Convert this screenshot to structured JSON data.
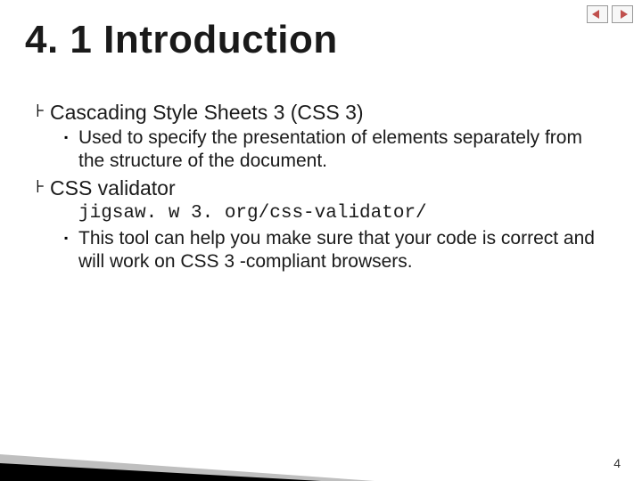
{
  "nav": {
    "prev_icon": "◄",
    "next_icon": "►"
  },
  "title": "4. 1 Introduction",
  "bullets": {
    "b1": {
      "label": "Cascading Style Sheets 3 (CSS 3)",
      "s1": "Used to specify the presentation of elements separately from the structure of the document."
    },
    "b2": {
      "label": "CSS validator",
      "code": "jigsaw. w 3. org/css-validator/",
      "s1": "This tool can help you make sure that your code is correct and will work on CSS 3 -compliant browsers."
    }
  },
  "page_number": "4"
}
